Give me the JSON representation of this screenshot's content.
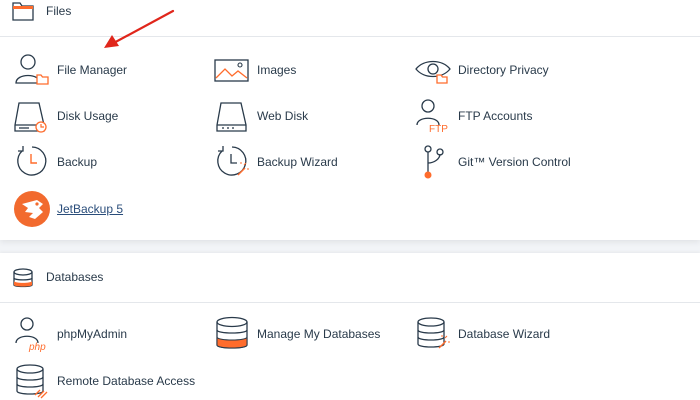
{
  "files": {
    "title": "Files",
    "items": [
      {
        "label": "File Manager"
      },
      {
        "label": "Images"
      },
      {
        "label": "Directory Privacy"
      },
      {
        "label": "Disk Usage"
      },
      {
        "label": "Web Disk"
      },
      {
        "label": "FTP Accounts"
      },
      {
        "label": "Backup"
      },
      {
        "label": "Backup Wizard"
      },
      {
        "label": "Git™ Version Control"
      },
      {
        "label": "JetBackup 5"
      }
    ]
  },
  "databases": {
    "title": "Databases",
    "items": [
      {
        "label": "phpMyAdmin"
      },
      {
        "label": "Manage My Databases"
      },
      {
        "label": "Database Wizard"
      },
      {
        "label": "Remote Database Access"
      }
    ]
  },
  "icon_text": {
    "ftp": "FTP",
    "php": "php"
  },
  "colors": {
    "accent": "#ff6c2c",
    "annotation_arrow": "#e0261b",
    "icon_stroke": "#293a4a",
    "text": "#293a4a"
  }
}
